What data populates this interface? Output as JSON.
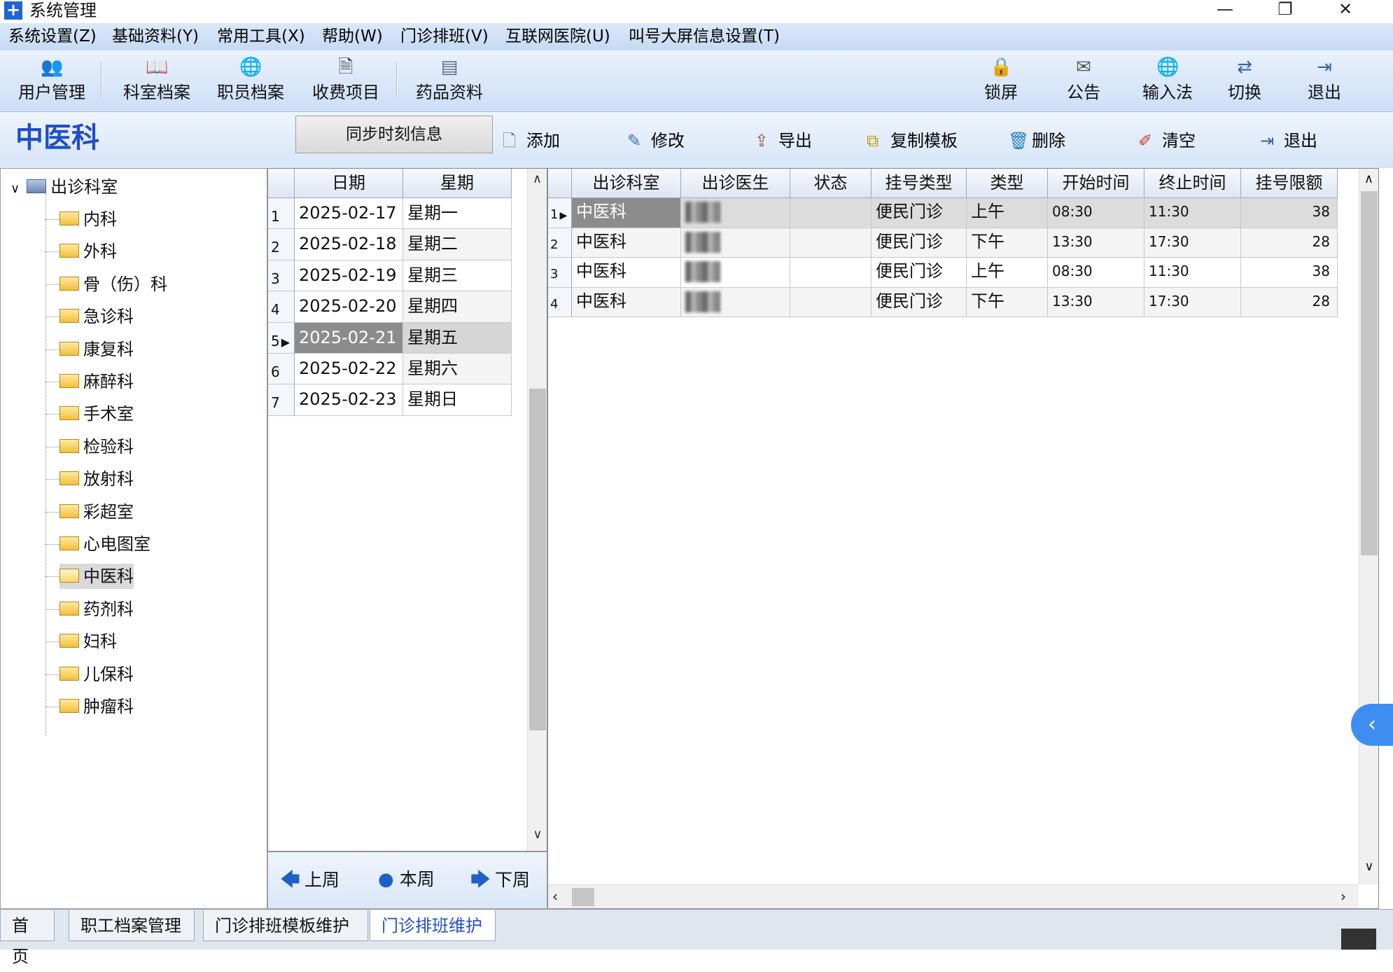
{
  "window": {
    "title": "系统管理",
    "minimize": "—",
    "restore": "❐",
    "close": "✕"
  },
  "menu": [
    "系统设置(Z)",
    "基础资料(Y)",
    "常用工具(X)",
    "帮助(W)",
    "门诊排班(V)",
    "互联网医院(U)",
    "叫号大屏信息设置(T)"
  ],
  "toolbar_left": [
    {
      "label": "用户管理",
      "icon": "users-icon"
    },
    {
      "label": "科室档案",
      "icon": "book-icon"
    },
    {
      "label": "职员档案",
      "icon": "globe-person-icon"
    },
    {
      "label": "收费项目",
      "icon": "document-icon"
    },
    {
      "label": "药品资料",
      "icon": "list-document-icon"
    }
  ],
  "toolbar_right": [
    {
      "label": "锁屏",
      "icon": "lock-screen-icon"
    },
    {
      "label": "公告",
      "icon": "notice-icon"
    },
    {
      "label": "输入法",
      "icon": "globe-icon"
    },
    {
      "label": "切换",
      "icon": "switch-icon"
    },
    {
      "label": "退出",
      "icon": "exit-icon"
    }
  ],
  "dept_title": "中医科",
  "sync_button": "同步时刻信息",
  "actions": [
    {
      "label": "添加",
      "icon": "page-icon"
    },
    {
      "label": "修改",
      "icon": "edit-icon"
    },
    {
      "label": "导出",
      "icon": "export-icon"
    },
    {
      "label": "复制模板",
      "icon": "copy-icon"
    },
    {
      "label": "删除",
      "icon": "trash-icon"
    },
    {
      "label": "清空",
      "icon": "eraser-icon"
    },
    {
      "label": "退出",
      "icon": "exit-icon"
    }
  ],
  "tree": {
    "root": "出诊科室",
    "children": [
      "内科",
      "外科",
      "骨（伤）科",
      "急诊科",
      "康复科",
      "麻醉科",
      "手术室",
      "检验科",
      "放射科",
      "彩超室",
      "心电图室",
      "中医科",
      "药剂科",
      "妇科",
      "儿保科",
      "肿瘤科"
    ],
    "selected": "中医科"
  },
  "week_grid": {
    "headers": [
      "日期",
      "星期"
    ],
    "rows": [
      {
        "n": "1",
        "date": "2025-02-17",
        "day": "星期一"
      },
      {
        "n": "2",
        "date": "2025-02-18",
        "day": "星期二"
      },
      {
        "n": "3",
        "date": "2025-02-19",
        "day": "星期三"
      },
      {
        "n": "4",
        "date": "2025-02-20",
        "day": "星期四"
      },
      {
        "n": "5",
        "date": "2025-02-21",
        "day": "星期五"
      },
      {
        "n": "6",
        "date": "2025-02-22",
        "day": "星期六"
      },
      {
        "n": "7",
        "date": "2025-02-23",
        "day": "星期日"
      }
    ],
    "selected_row": "5"
  },
  "week_nav": {
    "prev": "上周",
    "current": "本周",
    "next": "下周"
  },
  "schedule_grid": {
    "headers": [
      "出诊科室",
      "出诊医生",
      "状态",
      "挂号类型",
      "类型",
      "开始时间",
      "终止时间",
      "挂号限额"
    ],
    "rows": [
      {
        "n": "1",
        "dept": "中医科",
        "doctor": "",
        "status": "",
        "reg_type": "便民门诊",
        "type": "上午",
        "start": "08:30",
        "end": "11:30",
        "limit": "38"
      },
      {
        "n": "2",
        "dept": "中医科",
        "doctor": "",
        "status": "",
        "reg_type": "便民门诊",
        "type": "下午",
        "start": "13:30",
        "end": "17:30",
        "limit": "28"
      },
      {
        "n": "3",
        "dept": "中医科",
        "doctor": "",
        "status": "",
        "reg_type": "便民门诊",
        "type": "上午",
        "start": "08:30",
        "end": "11:30",
        "limit": "38"
      },
      {
        "n": "4",
        "dept": "中医科",
        "doctor": "",
        "status": "",
        "reg_type": "便民门诊",
        "type": "下午",
        "start": "13:30",
        "end": "17:30",
        "limit": "28"
      }
    ]
  },
  "bottom_tabs": [
    "首页",
    "职工档案管理",
    "门诊排班模板维护",
    "门诊排班维护"
  ],
  "active_tab": "门诊排班维护"
}
